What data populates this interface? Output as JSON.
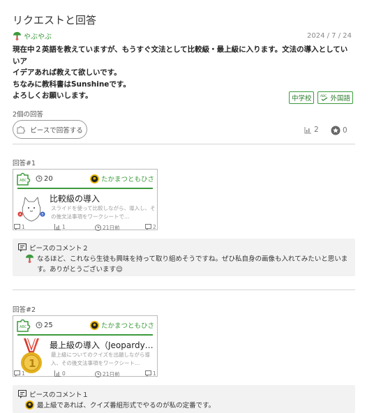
{
  "page": {
    "title": "リクエストと回答"
  },
  "request": {
    "author": "やぶやぶ",
    "date": "2024 / 7 / 24",
    "body_lines": [
      "現在中２英語を教えていますが、もうすぐ文法として比較級・最上級に入ります。文法の導入としていいア",
      "イデアあれば教えて欲しいです。",
      "ちなみに教科書はSunshineです。",
      "よろしくお願いします。"
    ],
    "tags": [
      {
        "label": "中学校",
        "icon": ""
      },
      {
        "label": "外国語",
        "icon": "abc-icon"
      }
    ]
  },
  "answers_summary": {
    "count_label": "2個の回答",
    "answer_button_label": "ピースで回答する",
    "chart_count": "2",
    "star_count": "0"
  },
  "answers": [
    {
      "label": "回答#1",
      "time": "20",
      "author": "たかまつともひさ",
      "title": "比較級の導入",
      "description": "スライドを使って比較しながら、導入し、その後文法事項をワークシートで…",
      "stats": {
        "comments": "1",
        "charts": "1",
        "time_ago": "21日前",
        "replies": "2"
      },
      "thumb": "cat-illustration",
      "comment_header": "ピースのコメント２",
      "comment_avatar": "yabuyabu-avatar",
      "comment_text": "なるほど、これなら生徒も興味を持って取り組めそうですね。ぜひ私自身の画像も入れてみたいと思います。ありがとうございます😌"
    },
    {
      "label": "回答#2",
      "time": "25",
      "author": "たかまつともひさ",
      "title": "最上級の導入（Jeopardy…",
      "description": "最上級についてのクイズを出題しながら導入、その後文法事項をワークシート…",
      "stats": {
        "comments": "1",
        "charts": "0",
        "time_ago": "21日前",
        "replies": "1"
      },
      "thumb": "gold-medal",
      "comment_header": "ピースのコメント１",
      "comment_avatar": "takamatsu-avatar",
      "comment_text": "最上級であれば、クイズ番組形式でやるのが私の定番です。"
    }
  ],
  "colors": {
    "accent_green": "#3c9a3c",
    "medal_gold": "#e3b11c",
    "ribbon_red": "#d8362b"
  }
}
